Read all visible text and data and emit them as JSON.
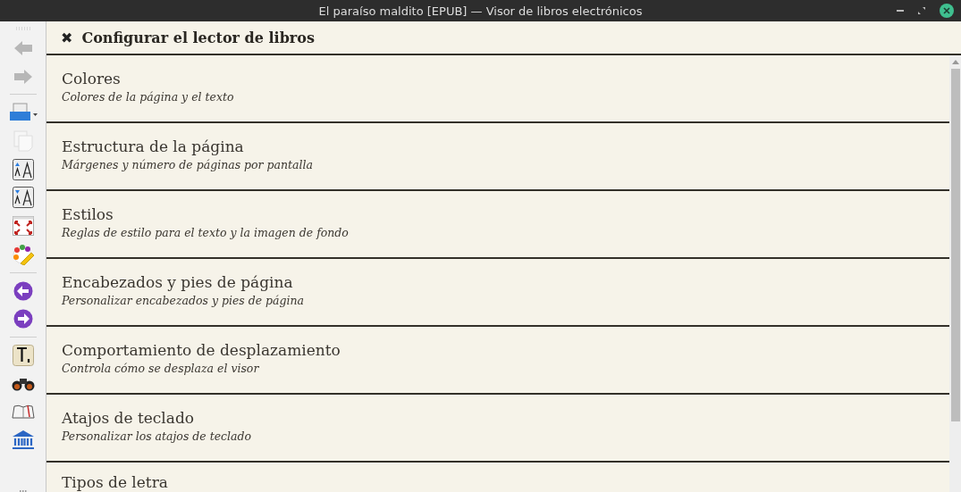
{
  "window": {
    "title": "El paraíso maldito [EPUB] — Visor de libros electrónicos"
  },
  "panel": {
    "close_glyph": "✖",
    "title": "Configurar el lector de libros"
  },
  "sections": [
    {
      "title": "Colores",
      "description": "Colores de la página y el texto"
    },
    {
      "title": "Estructura de la página",
      "description": "Márgenes y número de páginas por pantalla"
    },
    {
      "title": "Estilos",
      "description": "Reglas de estilo para el texto y la imagen de fondo"
    },
    {
      "title": "Encabezados y pies de página",
      "description": "Personalizar encabezados y pies de página"
    },
    {
      "title": "Comportamiento de desplazamiento",
      "description": "Controla cómo se desplaza el visor"
    },
    {
      "title": "Atajos de teclado",
      "description": "Personalizar los atajos de teclado"
    },
    {
      "title": "Tipos de letra"
    }
  ],
  "toolbar": [
    {
      "kind": "back",
      "disabled": true
    },
    {
      "kind": "forward",
      "disabled": true
    },
    {
      "kind": "separator"
    },
    {
      "kind": "print",
      "disabled": false
    },
    {
      "kind": "copy",
      "disabled": true
    },
    {
      "kind": "font-larger",
      "disabled": false
    },
    {
      "kind": "font-smaller",
      "disabled": false
    },
    {
      "kind": "fullscreen",
      "disabled": false
    },
    {
      "kind": "palette",
      "disabled": false
    },
    {
      "kind": "separator"
    },
    {
      "kind": "previous",
      "disabled": false
    },
    {
      "kind": "next",
      "disabled": false
    },
    {
      "kind": "separator"
    },
    {
      "kind": "text",
      "disabled": false
    },
    {
      "kind": "binoculars",
      "disabled": false
    },
    {
      "kind": "book",
      "disabled": false
    },
    {
      "kind": "library",
      "disabled": false
    }
  ]
}
